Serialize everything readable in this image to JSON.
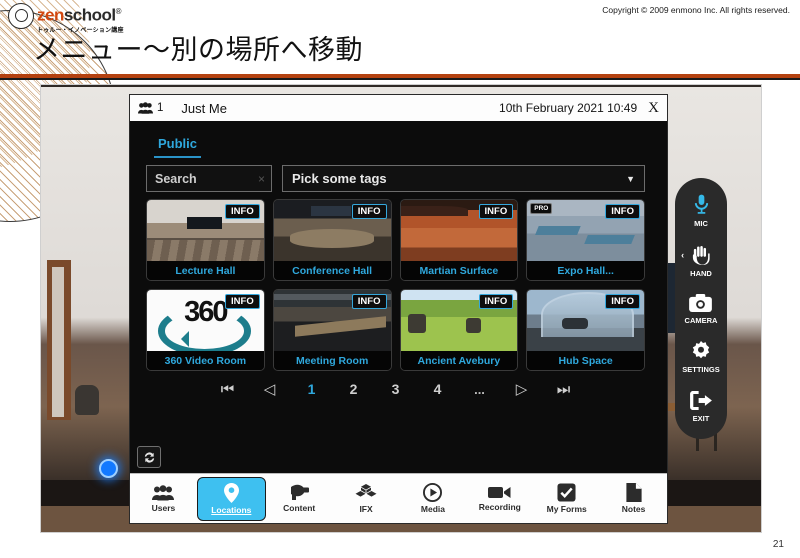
{
  "slide": {
    "logo_main_1": "zen",
    "logo_main_2": "school",
    "logo_reg": "®",
    "logo_sub": "トゥルー・イノベーション講座",
    "copyright": "Copyright © 2009 enmono Inc. All rights reserved.",
    "title": "メニュー〜別の場所へ移動",
    "page_number": "21",
    "accent_color": "#b4410f"
  },
  "dialog": {
    "participant_count": "1",
    "session_label": "Just Me",
    "datetime": "10th February 2021 10:49",
    "close_label": "X",
    "tabs": [
      {
        "label": "Public",
        "active": true
      }
    ],
    "search": {
      "value": "Search",
      "placeholder": "Search",
      "clear_label": "×"
    },
    "tags": {
      "label": "Pick some tags",
      "caret": "▼"
    },
    "accent_color": "#2fa8dd",
    "rooms": [
      {
        "name": "Lecture Hall",
        "info": "INFO",
        "pro": false,
        "art": "th-lecture"
      },
      {
        "name": "Conference Hall",
        "info": "INFO",
        "pro": false,
        "art": "th-conf"
      },
      {
        "name": "Martian Surface",
        "info": "INFO",
        "pro": false,
        "art": "th-mars"
      },
      {
        "name": "Expo Hall...",
        "info": "INFO",
        "pro": true,
        "pro_label": "PRO",
        "art": "th-expo"
      },
      {
        "name": "360 Video Room",
        "info": "INFO",
        "pro": false,
        "art": "th-360",
        "art_text": "360"
      },
      {
        "name": "Meeting Room",
        "info": "INFO",
        "pro": false,
        "art": "th-meet"
      },
      {
        "name": "Ancient Avebury",
        "info": "INFO",
        "pro": false,
        "art": "th-aveb"
      },
      {
        "name": "Hub Space",
        "info": "INFO",
        "pro": false,
        "art": "th-hub"
      }
    ],
    "pagination": {
      "first": "⏮",
      "prev": "◁",
      "pages": [
        "1",
        "2",
        "3",
        "4"
      ],
      "ellipsis": "...",
      "next": "▷",
      "last": "⏭",
      "current": "1"
    },
    "refresh_icon": "refresh-icon",
    "toolbar": [
      {
        "label": "Users",
        "icon": "users-icon",
        "active": false
      },
      {
        "label": "Locations",
        "icon": "location-pin-icon",
        "active": true
      },
      {
        "label": "Content",
        "icon": "vr-headset-icon",
        "active": false
      },
      {
        "label": "IFX",
        "icon": "cubes-icon",
        "active": false
      },
      {
        "label": "Media",
        "icon": "play-circle-icon",
        "active": false
      },
      {
        "label": "Recording",
        "icon": "video-camera-icon",
        "active": false
      },
      {
        "label": "My Forms",
        "icon": "check-square-icon",
        "active": false
      },
      {
        "label": "Notes",
        "icon": "document-icon",
        "active": false
      }
    ]
  },
  "vr_menu": [
    {
      "label": "MIC",
      "icon": "microphone-icon",
      "color": "#35b9e8",
      "chevron": ""
    },
    {
      "label": "HAND",
      "icon": "hand-icon",
      "color": "#ffffff",
      "chevron": "‹"
    },
    {
      "label": "CAMERA",
      "icon": "camera-icon",
      "color": "#ffffff",
      "chevron": ""
    },
    {
      "label": "SETTINGS",
      "icon": "gear-icon",
      "color": "#ffffff",
      "chevron": ""
    },
    {
      "label": "EXIT",
      "icon": "exit-icon",
      "color": "#ffffff",
      "chevron": ""
    }
  ]
}
